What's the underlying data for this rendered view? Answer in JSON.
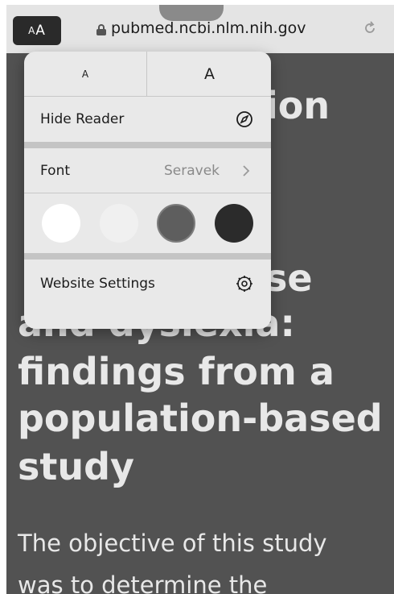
{
  "toolbar": {
    "aa_small": "A",
    "aa_large": "A",
    "url": "pubmed.ncbi.nlm.nih.gov",
    "lock_icon": "lock-icon",
    "reload_icon": "reload-icon"
  },
  "article": {
    "title_lines": [
      "ion",
      "se",
      "and dyslexia:",
      "findings from a",
      "population-based",
      "study"
    ],
    "body_lines": [
      "The objective of this study",
      "was to determine the"
    ]
  },
  "reader_menu": {
    "font_smaller": "A",
    "font_larger": "A",
    "hide_reader": "Hide Reader",
    "hide_reader_icon": "compass-icon",
    "font_label": "Font",
    "font_value": "Seravek",
    "themes": [
      "white",
      "light",
      "gray",
      "dark"
    ],
    "website_settings": "Website Settings",
    "website_settings_icon": "gear-icon"
  },
  "colors": {
    "page_background": "#525252",
    "menu_background": "#e9e9e9",
    "title_text": "#e8e8e8"
  }
}
